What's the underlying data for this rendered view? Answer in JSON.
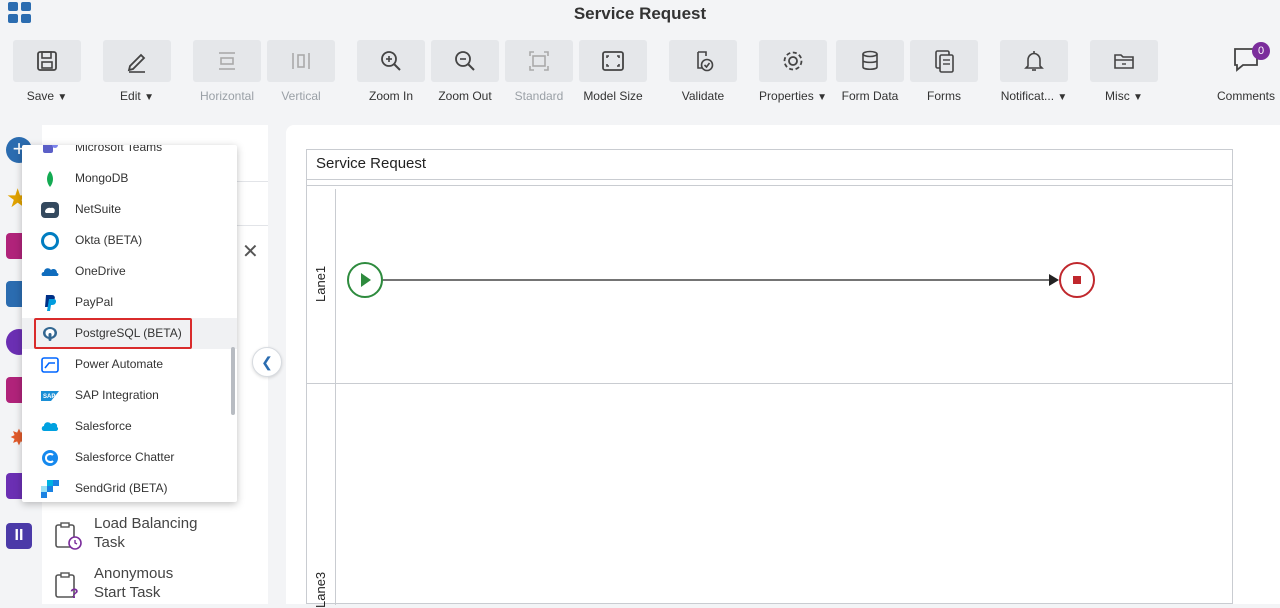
{
  "app": {
    "title": "Service Request"
  },
  "toolbar": {
    "save": "Save",
    "edit": "Edit",
    "horizontal": "Horizontal",
    "vertical": "Vertical",
    "zoom_in": "Zoom In",
    "zoom_out": "Zoom Out",
    "standard": "Standard",
    "model_size": "Model Size",
    "validate": "Validate",
    "properties": "Properties",
    "form_data": "Form Data",
    "forms": "Forms",
    "notifications": "Notificat...",
    "misc": "Misc",
    "comments": "Comments",
    "comments_count": "0"
  },
  "dropdown": {
    "items": [
      {
        "label": "Microsoft Teams",
        "icon": "microsoft-teams-icon"
      },
      {
        "label": "MongoDB",
        "icon": "mongodb-icon"
      },
      {
        "label": "NetSuite",
        "icon": "netsuite-icon"
      },
      {
        "label": "Okta (BETA)",
        "icon": "okta-icon"
      },
      {
        "label": "OneDrive",
        "icon": "onedrive-icon"
      },
      {
        "label": "PayPal",
        "icon": "paypal-icon"
      },
      {
        "label": "PostgreSQL (BETA)",
        "icon": "postgresql-icon",
        "highlighted": true
      },
      {
        "label": "Power Automate",
        "icon": "power-automate-icon"
      },
      {
        "label": "SAP Integration",
        "icon": "sap-icon"
      },
      {
        "label": "Salesforce",
        "icon": "salesforce-icon"
      },
      {
        "label": "Salesforce Chatter",
        "icon": "salesforce-chatter-icon"
      },
      {
        "label": "SendGrid (BETA)",
        "icon": "sendgrid-icon"
      }
    ]
  },
  "sidepanel": {
    "tasks": [
      {
        "label_line1": "Load Balancing",
        "label_line2": "Task"
      },
      {
        "label_line1": "Anonymous",
        "label_line2": "Start Task"
      }
    ]
  },
  "canvas": {
    "pool_title": "Service Request",
    "lanes": [
      "Lane1",
      "Lane3"
    ]
  },
  "colors": {
    "start_event": "#2e8b3e",
    "end_event": "#c0282d",
    "highlight_border": "#d92b2b",
    "accent_blue": "#2b6cb0"
  }
}
